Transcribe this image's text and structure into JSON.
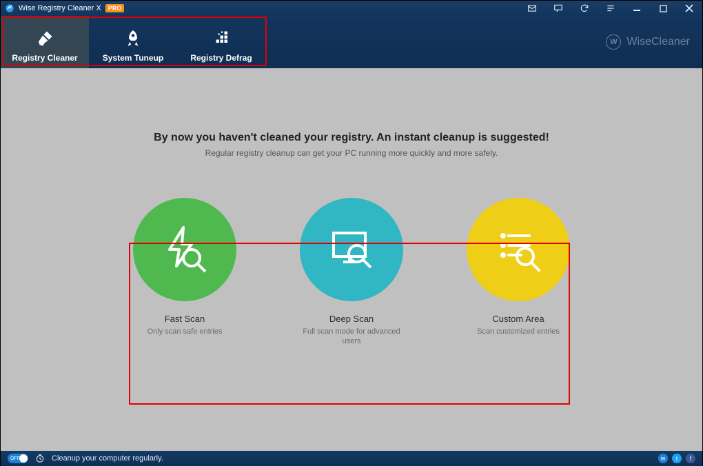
{
  "titlebar": {
    "app_title": "Wise Registry Cleaner X",
    "pro_badge": "PRO"
  },
  "tabs": [
    {
      "label": "Registry Cleaner",
      "icon": "brush-icon",
      "active": true
    },
    {
      "label": "System Tuneup",
      "icon": "rocket-icon",
      "active": false
    },
    {
      "label": "Registry Defrag",
      "icon": "defrag-icon",
      "active": false
    }
  ],
  "brand": "WiseCleaner",
  "main": {
    "headline": "By now you haven't cleaned your registry. An instant cleanup is suggested!",
    "subhead": "Regular registry cleanup can get your PC running more quickly and more safely.",
    "scan_options": [
      {
        "title": "Fast Scan",
        "desc": "Only scan safe entries",
        "color": "green"
      },
      {
        "title": "Deep Scan",
        "desc": "Full scan mode for advanced users",
        "color": "blue"
      },
      {
        "title": "Custom Area",
        "desc": "Scan customized entries",
        "color": "yellow"
      }
    ]
  },
  "statusbar": {
    "toggle_label": "OFF",
    "tip": "Cleanup your computer regularly."
  }
}
